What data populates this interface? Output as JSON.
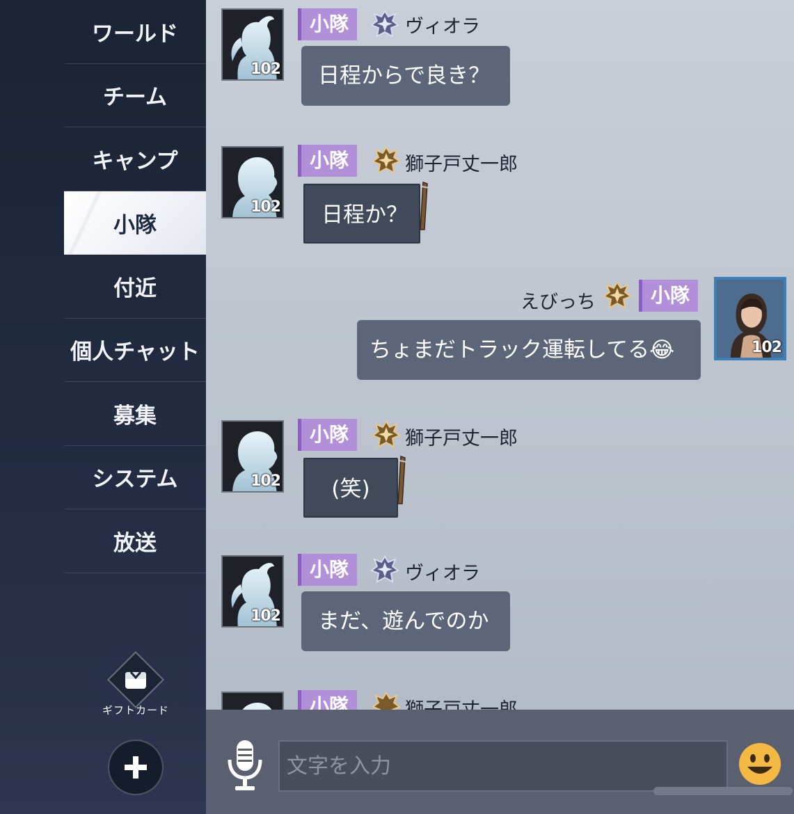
{
  "sidebar": {
    "items": [
      {
        "label": "ワールド"
      },
      {
        "label": "チーム"
      },
      {
        "label": "キャンプ"
      },
      {
        "label": "小隊"
      },
      {
        "label": "付近"
      },
      {
        "label": "個人チャット"
      },
      {
        "label": "募集"
      },
      {
        "label": "システム"
      },
      {
        "label": "放送"
      }
    ],
    "active": "小隊",
    "gift_label": "ギフトカード"
  },
  "messages": [
    {
      "tag": "小隊",
      "name": "ヴィオラ",
      "text": "日程からで良き？",
      "level": "102",
      "side": "left",
      "avatar": "ponytail-silhouette",
      "rank": "silver-rank-icon"
    },
    {
      "tag": "小隊",
      "name": "獅子戸丈一郎",
      "text": "日程か？",
      "level": "102",
      "side": "left",
      "avatar": "male-silhouette",
      "rank": "gold-rank-icon"
    },
    {
      "tag": "小隊",
      "name": "えびっち",
      "text": "ちょまだトラック運転してる😂",
      "level": "102",
      "side": "right",
      "avatar": "portrait",
      "rank": "gold-rank-icon"
    },
    {
      "tag": "小隊",
      "name": "獅子戸丈一郎",
      "text": "(笑)",
      "level": "102",
      "side": "left",
      "avatar": "male-silhouette",
      "rank": "gold-rank-icon"
    },
    {
      "tag": "小隊",
      "name": "ヴィオラ",
      "text": "まだ、遊んでのか",
      "level": "102",
      "side": "left",
      "avatar": "ponytail-silhouette",
      "rank": "silver-rank-icon"
    },
    {
      "tag": "小隊",
      "name": "獅子戸丈一郎",
      "text": "",
      "level": "",
      "side": "left",
      "avatar": "male-silhouette",
      "rank": "gold-rank-icon"
    }
  ],
  "input": {
    "placeholder": "文字を入力"
  },
  "colors": {
    "tag_bg": "#b28fd9",
    "bubble_bg": "#5c6678",
    "sidebar_bg": "#1b2434"
  }
}
